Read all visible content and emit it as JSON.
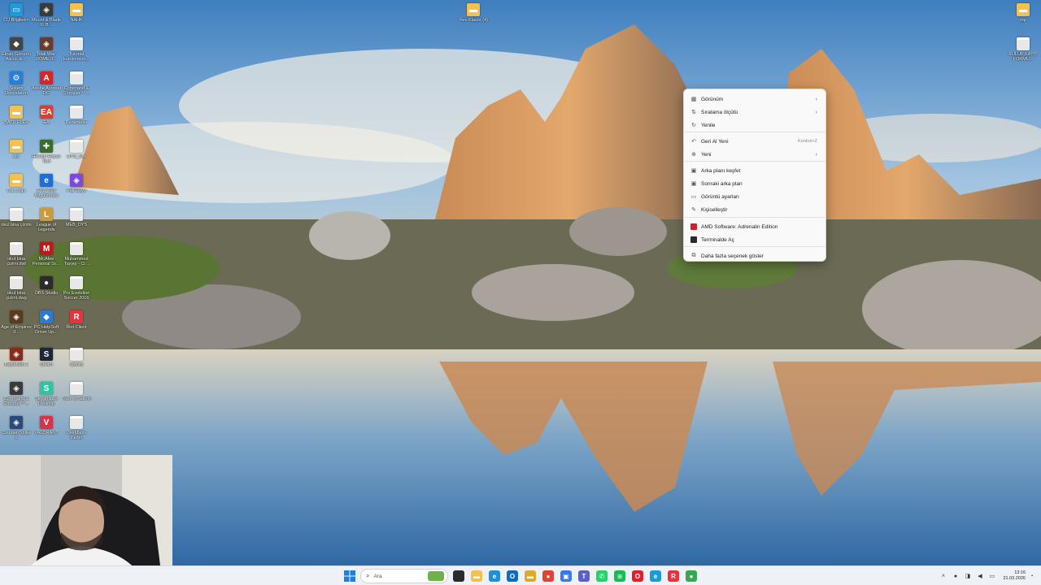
{
  "desktop_icons": [
    {
      "id": "cu",
      "label": "CU Bilgilerim",
      "icon": "monitor-icon",
      "color": "#1e9ad6"
    },
    {
      "id": "mount-blade",
      "label": "Mount & Blade II: B...",
      "icon": "game-icon",
      "color": "#3a3a3a"
    },
    {
      "id": "nahk",
      "label": "NAHK",
      "icon": "folder-icon",
      "color": "#f2c14e"
    },
    {
      "id": "yeni-klasor",
      "label": "Yeni Klasör (4)",
      "icon": "folder-icon",
      "color": "#f2c14e"
    },
    {
      "id": "ntp",
      "label": "ntp",
      "icon": "folder-icon",
      "color": "#f2c14e"
    },
    {
      "id": "ekran-goruntu",
      "label": "Ekran Görüntü Alıcısı & ...",
      "icon": "app-icon",
      "color": "#444"
    },
    {
      "id": "total-war",
      "label": "Total War: ROME II...",
      "icon": "game-icon",
      "color": "#6b3b2a"
    },
    {
      "id": "tutorial",
      "label": "Tutorial kuruyorsun...",
      "icon": "document-icon",
      "color": "#e8e8e8"
    },
    {
      "id": "kulup",
      "label": "KULÜP KAYIT FORMU...",
      "icon": "document-icon",
      "color": "#e8e8e8"
    },
    {
      "id": "sistem",
      "label": "Sistem Dosyalarım",
      "icon": "settings-icon",
      "color": "#2a7fd4"
    },
    {
      "id": "acrobat",
      "label": "Adobe Acrobat DC",
      "icon": "pdf-icon",
      "color": "#d7262b"
    },
    {
      "id": "command-conquer",
      "label": "Command & Conquer™ ...",
      "icon": "document-icon",
      "color": "#e8e8e8"
    },
    {
      "id": "batu-flex",
      "label": "BATU FLEX",
      "icon": "folder-icon",
      "color": "#f2c14e"
    },
    {
      "id": "ea",
      "label": "EA",
      "icon": "ea-icon",
      "color": "#e03b2c"
    },
    {
      "id": "denemeler",
      "label": "Denemeler",
      "icon": "document-icon",
      "color": "#e8e8e8"
    },
    {
      "id": "drs",
      "label": "drs",
      "icon": "folder-icon",
      "color": "#f2c14e"
    },
    {
      "id": "hetech",
      "label": "Hetech Repair Tool",
      "icon": "tool-icon",
      "color": "#3a6d2a"
    },
    {
      "id": "dys-kur",
      "label": "DYS_Kur",
      "icon": "document-icon",
      "color": "#e8e8e8"
    },
    {
      "id": "lol-logs",
      "label": "LoL Logs",
      "icon": "folder-icon",
      "color": "#f2c14e"
    },
    {
      "id": "eyz",
      "label": "EYZ Web Uygulaması",
      "icon": "web-icon",
      "color": "#1b6fd6"
    },
    {
      "id": "fall-guys",
      "label": "Fall Guys",
      "icon": "game-icon",
      "color": "#7b4bd8"
    },
    {
      "id": "okul-bina",
      "label": "okul bina çizimi",
      "icon": "document-icon",
      "color": "#e8e8e8"
    },
    {
      "id": "lol",
      "label": "League of Legends",
      "icon": "lol-icon",
      "color": "#c89b3c"
    },
    {
      "id": "meb-dys",
      "label": "MEB_DYS",
      "icon": "document-icon",
      "color": "#e8e8e8"
    },
    {
      "id": "okul-bina-cizimi",
      "label": "okul bina çizimi.dwl",
      "icon": "document-icon",
      "color": "#e8e8e8"
    },
    {
      "id": "mcafee",
      "label": "McAfee Personal Sc...",
      "icon": "shield-icon",
      "color": "#c01818"
    },
    {
      "id": "muhammed",
      "label": "Muhammed Tayyip - Ci...",
      "icon": "document-icon",
      "color": "#e8e8e8"
    },
    {
      "id": "okul-bina-dwg",
      "label": "okul bina çizimi.dwg",
      "icon": "document-icon",
      "color": "#e8e8e8"
    },
    {
      "id": "obs",
      "label": "OBS Studio",
      "icon": "obs-icon",
      "color": "#2b2b2b"
    },
    {
      "id": "pes",
      "label": "Pro Evolution Soccer 2016",
      "icon": "document-icon",
      "color": "#e8e8e8"
    },
    {
      "id": "aoe",
      "label": "Age of Empires II...",
      "icon": "game-icon",
      "color": "#5a3b1b"
    },
    {
      "id": "pc-helpsoft",
      "label": "PC HelpSoft Driver Up...",
      "icon": "app-icon",
      "color": "#2d7ad6"
    },
    {
      "id": "riot",
      "label": "Riot Client",
      "icon": "riot-icon",
      "color": "#e8323c"
    },
    {
      "id": "battlefield",
      "label": "Battlefield 1",
      "icon": "game-icon",
      "color": "#8a2a1a"
    },
    {
      "id": "steam",
      "label": "Steam",
      "icon": "steam-icon",
      "color": "#1b2838"
    },
    {
      "id": "spotify-desk",
      "label": "Spotify",
      "icon": "document-icon",
      "color": "#e8e8e8"
    },
    {
      "id": "cnc",
      "label": "Command & Conquer™...",
      "icon": "game-icon",
      "color": "#3a3a3a"
    },
    {
      "id": "streamlabs",
      "label": "Streamlabs Desktop",
      "icon": "streamlabs-icon",
      "color": "#31c3a2"
    },
    {
      "id": "town-salem",
      "label": "Town of Salem",
      "icon": "document-icon",
      "color": "#e8e8e8"
    },
    {
      "id": "counter-strike",
      "label": "Counter-Strike 2",
      "icon": "game-icon",
      "color": "#2a4a7a"
    },
    {
      "id": "valorant",
      "label": "VALORANT",
      "icon": "valorant-icon",
      "color": "#d6344a"
    },
    {
      "id": "worldless",
      "label": "Worldless Demo",
      "icon": "document-icon",
      "color": "#e8e8e8"
    }
  ],
  "context_menu": {
    "items": [
      {
        "label": "Görünüm",
        "icon": "grid-icon",
        "has_submenu": true
      },
      {
        "label": "Sıralama ölçütü",
        "icon": "sort-icon",
        "has_submenu": true
      },
      {
        "label": "Yenile",
        "icon": "refresh-icon",
        "has_submenu": false
      },
      {
        "label": "Geri Al Yeni",
        "icon": "undo-icon",
        "shortcut": "Kontrol+Z"
      },
      {
        "label": "Yeni",
        "icon": "new-icon",
        "has_submenu": true
      },
      {
        "label": "Arka planı keşfet",
        "icon": "image-icon"
      },
      {
        "label": "Sonraki arka plan",
        "icon": "image-next-icon"
      },
      {
        "label": "Görüntü ayarları",
        "icon": "display-icon"
      },
      {
        "label": "Kişiselleştir",
        "icon": "brush-icon"
      },
      {
        "label": "AMD Software: Adrenalin Edition",
        "icon": "amd-icon"
      },
      {
        "label": "Terminalde Aç",
        "icon": "terminal-icon"
      },
      {
        "label": "Daha fazla seçenek göster",
        "icon": "more-icon"
      }
    ],
    "chevron": "›"
  },
  "taskbar": {
    "search_placeholder": "Ara",
    "apps": [
      {
        "name": "explorer",
        "icon": "folder-icon",
        "color": "#f2c14e"
      },
      {
        "name": "edge",
        "icon": "edge-icon",
        "color": "#1f8fd8"
      },
      {
        "name": "outlook",
        "icon": "outlook-icon",
        "color": "#0f6cbd"
      },
      {
        "name": "files",
        "icon": "folder-icon",
        "color": "#e0a92c"
      },
      {
        "name": "chrome",
        "icon": "chrome-icon",
        "color": "#e34133"
      },
      {
        "name": "store",
        "icon": "store-icon",
        "color": "#3b78e7"
      },
      {
        "name": "teams",
        "icon": "teams-icon",
        "color": "#5b5fc7"
      },
      {
        "name": "whatsapp",
        "icon": "whatsapp-icon",
        "color": "#25d366"
      },
      {
        "name": "spotify",
        "icon": "spotify-icon",
        "color": "#1db954"
      },
      {
        "name": "opera",
        "icon": "opera-icon",
        "color": "#e0202a"
      },
      {
        "name": "edge2",
        "icon": "edge-icon",
        "color": "#1c9ad6"
      },
      {
        "name": "riot",
        "icon": "riot-icon",
        "color": "#e8323c"
      },
      {
        "name": "chrome2",
        "icon": "chrome-icon",
        "color": "#34a853"
      }
    ],
    "clock_time": "13:16",
    "clock_date": "21.03.2026"
  }
}
